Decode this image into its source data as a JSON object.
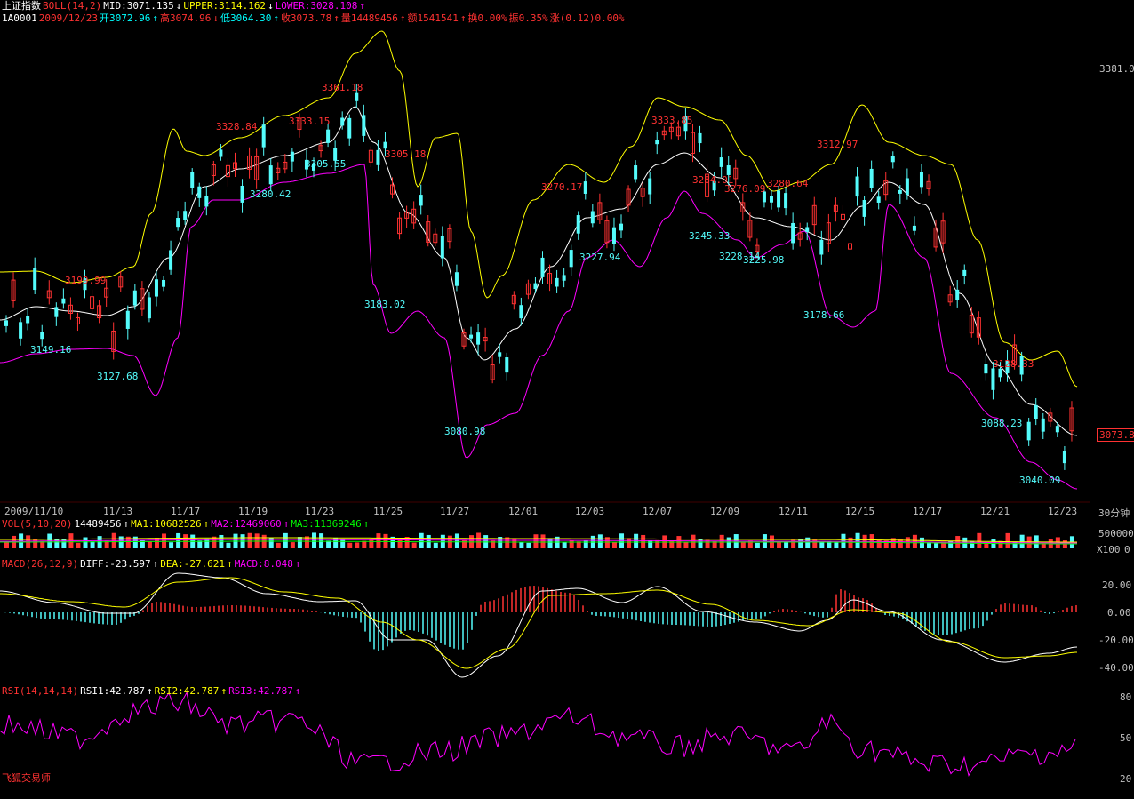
{
  "header": {
    "index_name": "上证指数",
    "boll_label": "BOLL(14,2)",
    "mid": "MID:3071.135",
    "upper": "UPPER:3114.162",
    "lower": "LOWER:3028.108",
    "code": "1A0001",
    "date": "2009/12/23",
    "open": "开3072.96",
    "high": "高3074.96",
    "low": "低3064.30",
    "close": "收3073.78",
    "volume": "量14489456",
    "amount": "额1541541",
    "turnover": "换0.00%",
    "amplitude": "振0.35%",
    "change": "涨(0.12)0.00%"
  },
  "price_axis": {
    "top_value": "3381.0",
    "current": "3073.8"
  },
  "price_labels": [
    {
      "text": "3361.18",
      "color": "red"
    },
    {
      "text": "3328.84",
      "color": "red"
    },
    {
      "text": "3333.15",
      "color": "red"
    },
    {
      "text": "3199.99",
      "color": "red"
    },
    {
      "text": "3305.18",
      "color": "red"
    },
    {
      "text": "3270.17",
      "color": "red"
    },
    {
      "text": "3333.85",
      "color": "red"
    },
    {
      "text": "3284.01",
      "color": "red"
    },
    {
      "text": "3276.09",
      "color": "red"
    },
    {
      "text": "3280.64",
      "color": "red"
    },
    {
      "text": "3312.97",
      "color": "red"
    },
    {
      "text": "3128.33",
      "color": "red"
    },
    {
      "text": "3149.16",
      "color": "cyan"
    },
    {
      "text": "3127.68",
      "color": "cyan"
    },
    {
      "text": "3305.55",
      "color": "cyan"
    },
    {
      "text": "3280.42",
      "color": "cyan"
    },
    {
      "text": "3183.02",
      "color": "cyan"
    },
    {
      "text": "3080.98",
      "color": "cyan"
    },
    {
      "text": "3227.94",
      "color": "cyan"
    },
    {
      "text": "3245.33",
      "color": "cyan"
    },
    {
      "text": "3228.14",
      "color": "cyan"
    },
    {
      "text": "3225.98",
      "color": "cyan"
    },
    {
      "text": "3178.66",
      "color": "cyan"
    },
    {
      "text": "3088.23",
      "color": "cyan"
    },
    {
      "text": "3040.09",
      "color": "cyan"
    }
  ],
  "date_axis": [
    "2009/11/10",
    "11/13",
    "11/17",
    "11/19",
    "11/23",
    "11/25",
    "11/27",
    "12/01",
    "12/03",
    "12/07",
    "12/09",
    "12/11",
    "12/15",
    "12/17",
    "12/21",
    "12/23"
  ],
  "period": "30分钟",
  "vol": {
    "label": "VOL(5,10,20)",
    "value": "14489456",
    "ma1": "MA1:10682526",
    "ma2": "MA2:12469060",
    "ma3": "MA3:11369246",
    "axis_top": "500000",
    "axis_bottom_unit": "X100",
    "axis_bottom": "0"
  },
  "macd": {
    "label": "MACD(26,12,9)",
    "diff": "DIFF:-23.597",
    "dea": "DEA:-27.621",
    "macd": "MACD:8.048",
    "axis": [
      "20.00",
      "0.00",
      "-20.00",
      "-40.00"
    ]
  },
  "rsi": {
    "label": "RSI(14,14,14)",
    "rsi1": "RSI1:42.787",
    "rsi2": "RSI2:42.787",
    "rsi3": "RSI3:42.787",
    "axis": [
      "80",
      "50",
      "20"
    ]
  },
  "footer_brand": "飞狐交易师",
  "colors": {
    "up": "#ff3232",
    "down": "#54fcfc",
    "upper": "#ffff00",
    "mid": "#ffffff",
    "lower": "#ff00ff",
    "dea": "#ffff00"
  },
  "chart_data": {
    "type": "line",
    "title": "上证指数 30分钟 BOLL(14,2)",
    "x": [
      "2009/11/10",
      "11/13",
      "11/17",
      "11/19",
      "11/23",
      "11/25",
      "11/27",
      "12/01",
      "12/03",
      "12/07",
      "12/09",
      "12/11",
      "12/15",
      "12/17",
      "12/21",
      "12/23"
    ],
    "series": [
      {
        "name": "price",
        "values": [
          3165,
          3160,
          3280,
          3295,
          3335,
          3190,
          3085,
          3220,
          3240,
          3320,
          3255,
          3240,
          3300,
          3200,
          3110,
          3073.78
        ]
      },
      {
        "name": "MID",
        "values": [
          3160,
          3150,
          3230,
          3270,
          3300,
          3290,
          3120,
          3170,
          3240,
          3290,
          3260,
          3230,
          3265,
          3230,
          3110,
          3071.135
        ]
      },
      {
        "name": "UPPER",
        "values": [
          3200,
          3195,
          3310,
          3320,
          3350,
          3340,
          3200,
          3260,
          3300,
          3370,
          3320,
          3290,
          3370,
          3300,
          3170,
          3114.162
        ]
      },
      {
        "name": "LOWER",
        "values": [
          3125,
          3105,
          3150,
          3215,
          3265,
          3200,
          3060,
          3090,
          3210,
          3225,
          3200,
          3180,
          3190,
          3150,
          3060,
          3028.108
        ]
      }
    ],
    "ylim": [
      3020,
      3400
    ]
  }
}
